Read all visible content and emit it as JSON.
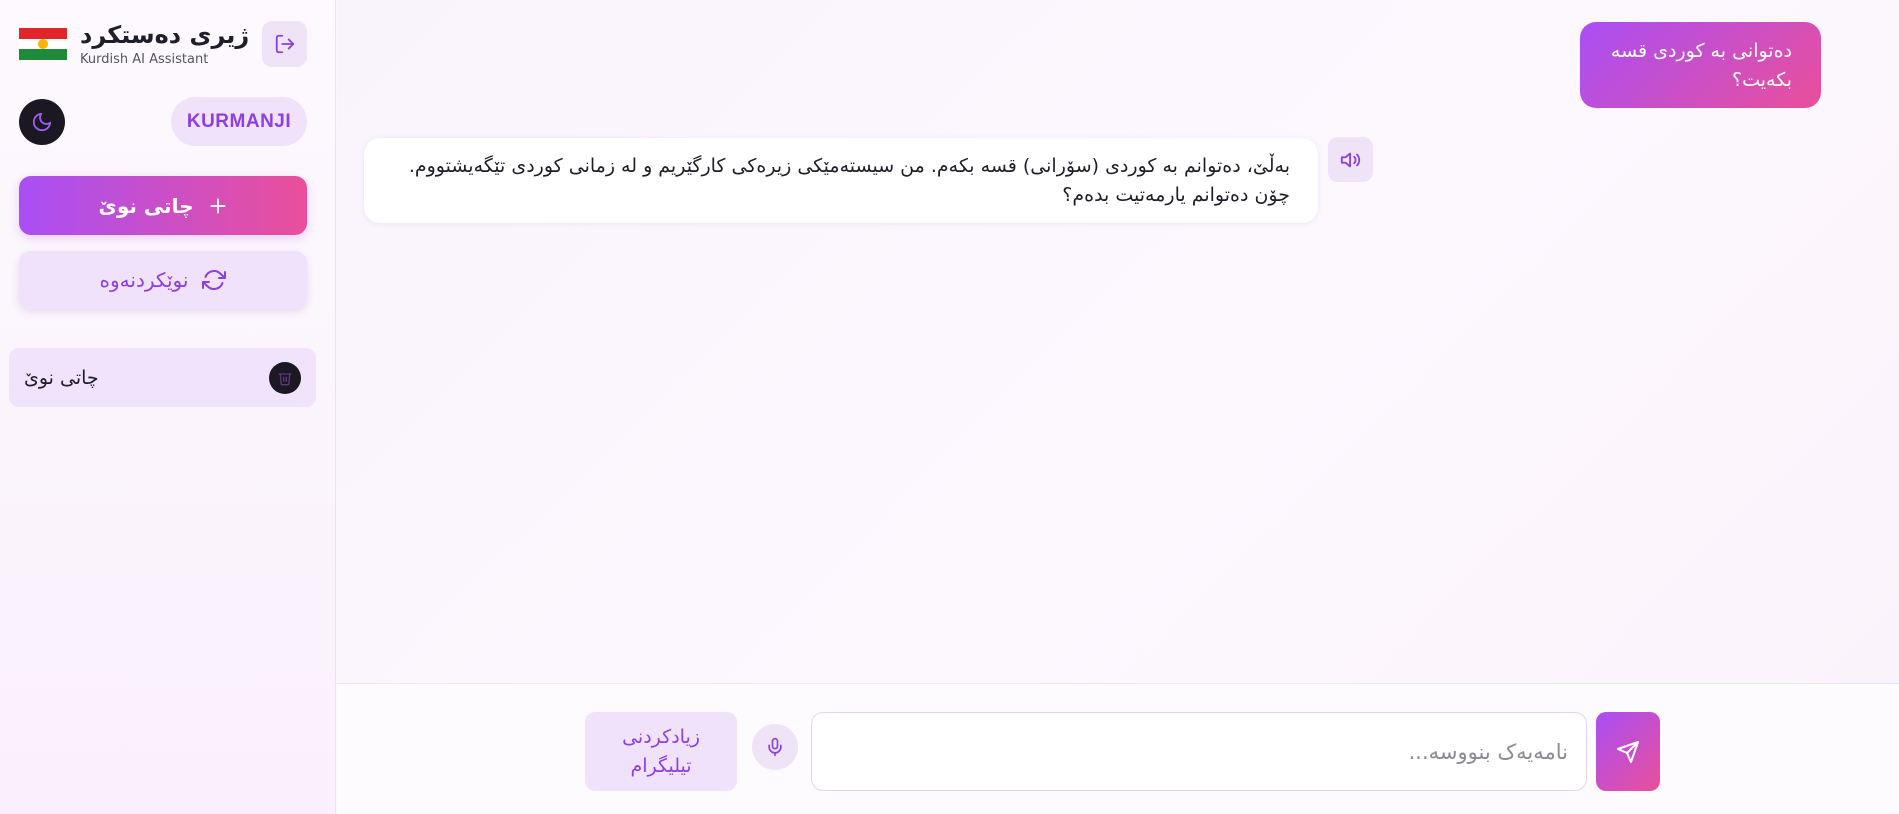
{
  "app": {
    "title": "ژیری دەستکرد",
    "subtitle": "Kurdish AI Assistant"
  },
  "sidebar": {
    "language_label": "KURMANJI",
    "new_chat_label": "چاتی نوێ",
    "refresh_label": "نوێکردنەوە",
    "chats": [
      {
        "title": "چاتی نوێ"
      }
    ]
  },
  "messages": [
    {
      "role": "user",
      "text": "دەتوانی بە کوردی قسە بکەیت؟"
    },
    {
      "role": "assistant",
      "text": "بەڵێ، دەتوانم بە کوردی (سۆرانی) قسە بکەم. من سیستەمێکی زیرەکی کارگێریم و لە زمانی کوردی تێگەیشتووم. چۆن دەتوانم یارمەتیت بدەم؟"
    }
  ],
  "composer": {
    "placeholder": "نامەیەک بنووسە...",
    "value": "",
    "telegram_label": "زیادکردنی تیلیگرام"
  },
  "colors": {
    "accent_purple": "#a94ff5",
    "accent_pink": "#ea4f9a",
    "soft_purple": "#f0e2fb",
    "dark": "#1b1723"
  },
  "icons": {
    "logout": "logout-icon",
    "theme": "moon-icon",
    "new_chat": "plus-icon",
    "refresh": "refresh-icon",
    "delete": "trash-icon",
    "speak": "speaker-icon",
    "mic": "microphone-icon",
    "send": "send-icon"
  }
}
